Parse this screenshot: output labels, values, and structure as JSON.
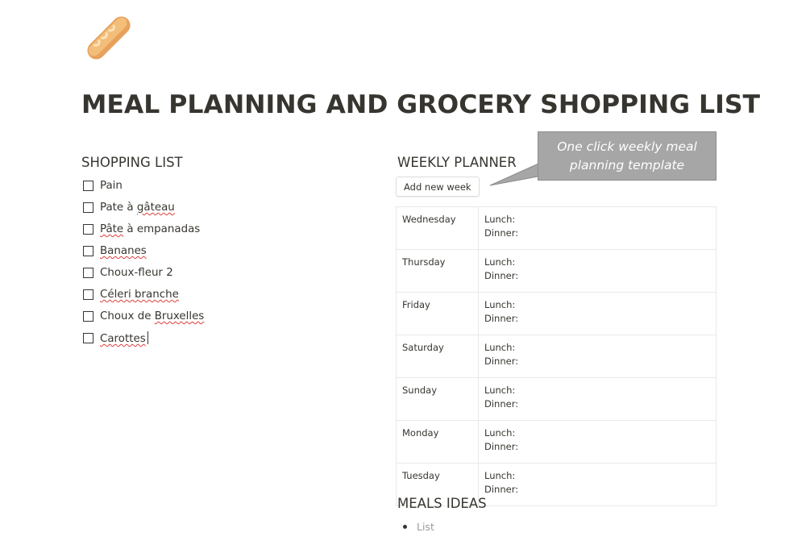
{
  "page": {
    "icon": "baguette-icon",
    "title": "MEAL PLANNING AND GROCERY SHOPPING LIST"
  },
  "shopping_list": {
    "heading": "SHOPPING LIST",
    "items": [
      {
        "label": "Pain",
        "checked": false
      },
      {
        "label": "Pate à gâteau",
        "checked": false
      },
      {
        "label": "Pâte à empanadas",
        "checked": false
      },
      {
        "label": "Bananes",
        "checked": false
      },
      {
        "label": "Choux-fleur 2",
        "checked": false
      },
      {
        "label": "Céleri branche",
        "checked": false
      },
      {
        "label": "Choux de Bruxelles",
        "checked": false
      },
      {
        "label": "Carottes",
        "checked": false
      }
    ]
  },
  "weekly_planner": {
    "heading": "WEEKLY PLANNER",
    "add_button": "Add new week",
    "rows": [
      {
        "day": "Wednesday",
        "lunch": "Lunch:",
        "dinner": "Dinner:"
      },
      {
        "day": "Thursday",
        "lunch": "Lunch:",
        "dinner": "Dinner:"
      },
      {
        "day": "Friday",
        "lunch": "Lunch:",
        "dinner": "Dinner:"
      },
      {
        "day": "Saturday",
        "lunch": "Lunch:",
        "dinner": "Dinner:"
      },
      {
        "day": "Sunday",
        "lunch": "Lunch:",
        "dinner": "Dinner:"
      },
      {
        "day": "Monday",
        "lunch": "Lunch:",
        "dinner": "Dinner:"
      },
      {
        "day": "Tuesday",
        "lunch": "Lunch:",
        "dinner": "Dinner:"
      }
    ]
  },
  "callout": {
    "line1": "One click weekly meal",
    "line2": "planning template",
    "color": "#a6a6a6"
  },
  "meals_ideas": {
    "heading": "MEALS IDEAS",
    "items": [
      "List"
    ]
  },
  "colors": {
    "text": "#37352f",
    "placeholder": "#9b9a97",
    "spellcheck": "#e03e3e"
  }
}
